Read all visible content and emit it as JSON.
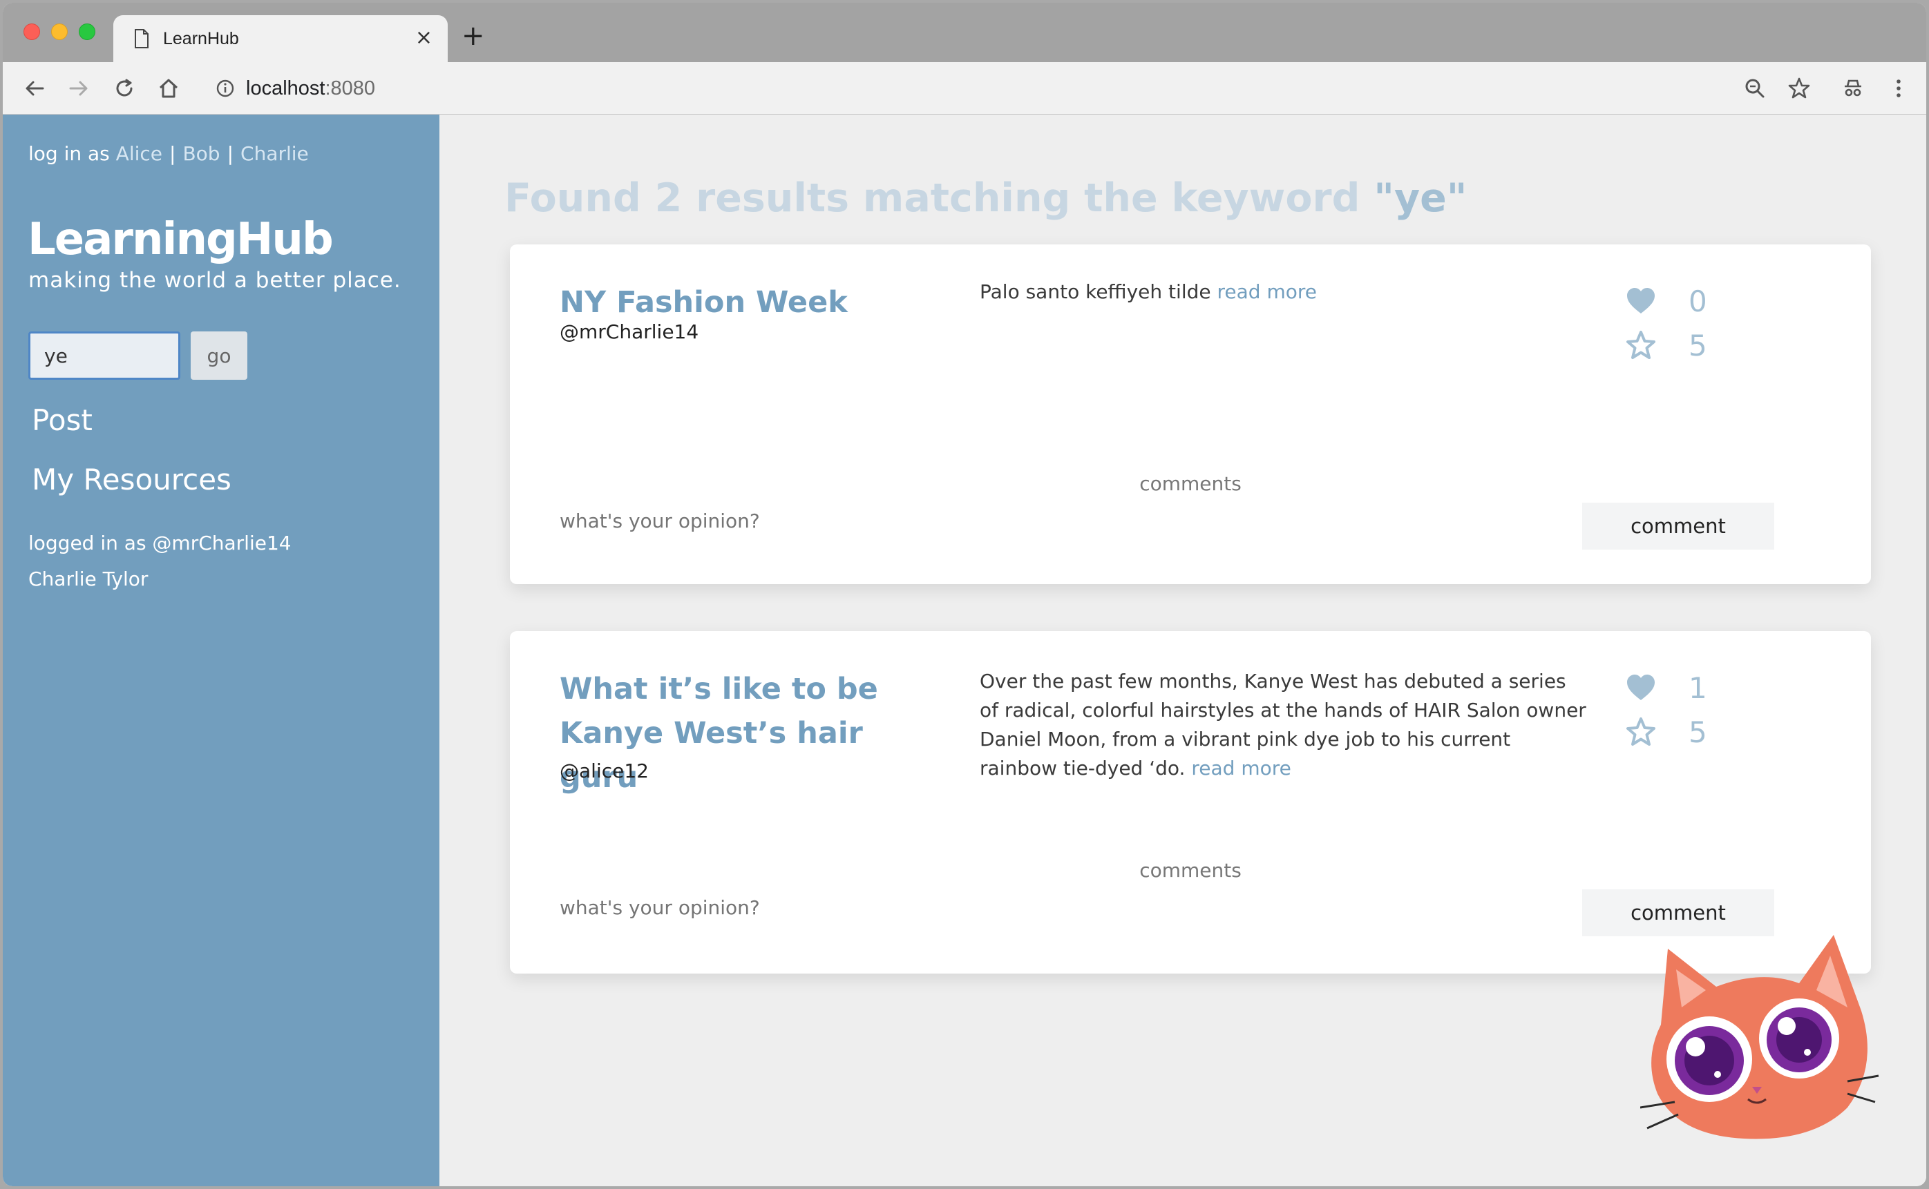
{
  "browser": {
    "tab_title": "LearnHub",
    "tab_close": "×",
    "new_tab": "+",
    "url_host": "localhost",
    "url_port": ":8080"
  },
  "sidebar": {
    "login_prefix": "log in as",
    "users": [
      "Alice",
      "Bob",
      "Charlie"
    ],
    "separator": "|",
    "brand": "LearningHub",
    "tagline": "making the world a better place.",
    "search_value": "ye",
    "go_label": "go",
    "nav_post": "Post",
    "nav_resources": "My Resources",
    "logged_in_as": "logged in as @mrCharlie14",
    "full_name": "Charlie Tylor"
  },
  "main": {
    "heading_prefix": "Found 2 results matching the keyword",
    "heading_keyword": "\"ye\""
  },
  "results": [
    {
      "title": "NY Fashion Week",
      "author": "@mrCharlie14",
      "description": "Palo santo keffiyeh tilde",
      "read_more": "read more",
      "likes": "0",
      "stars": "5",
      "comments_label": "comments",
      "opinion_placeholder": "what's your opinion?",
      "comment_button": "comment"
    },
    {
      "title": "What it’s like to be Kanye West’s hair guru",
      "author": "@alice12",
      "description": "Over the past few months, Kanye West has debuted a series of radical, colorful hairstyles at the hands of HAIR Salon owner Daniel Moon, from a vibrant pink dye job to his current rainbow tie-dyed ‘do.",
      "read_more": "read more",
      "likes": "1",
      "stars": "5",
      "comments_label": "comments",
      "opinion_placeholder": "what's your opinion?",
      "comment_button": "comment"
    }
  ],
  "colors": {
    "sidebar": "#729ebe",
    "accent": "#729ebe",
    "muted_accent": "#a3bfd3"
  }
}
